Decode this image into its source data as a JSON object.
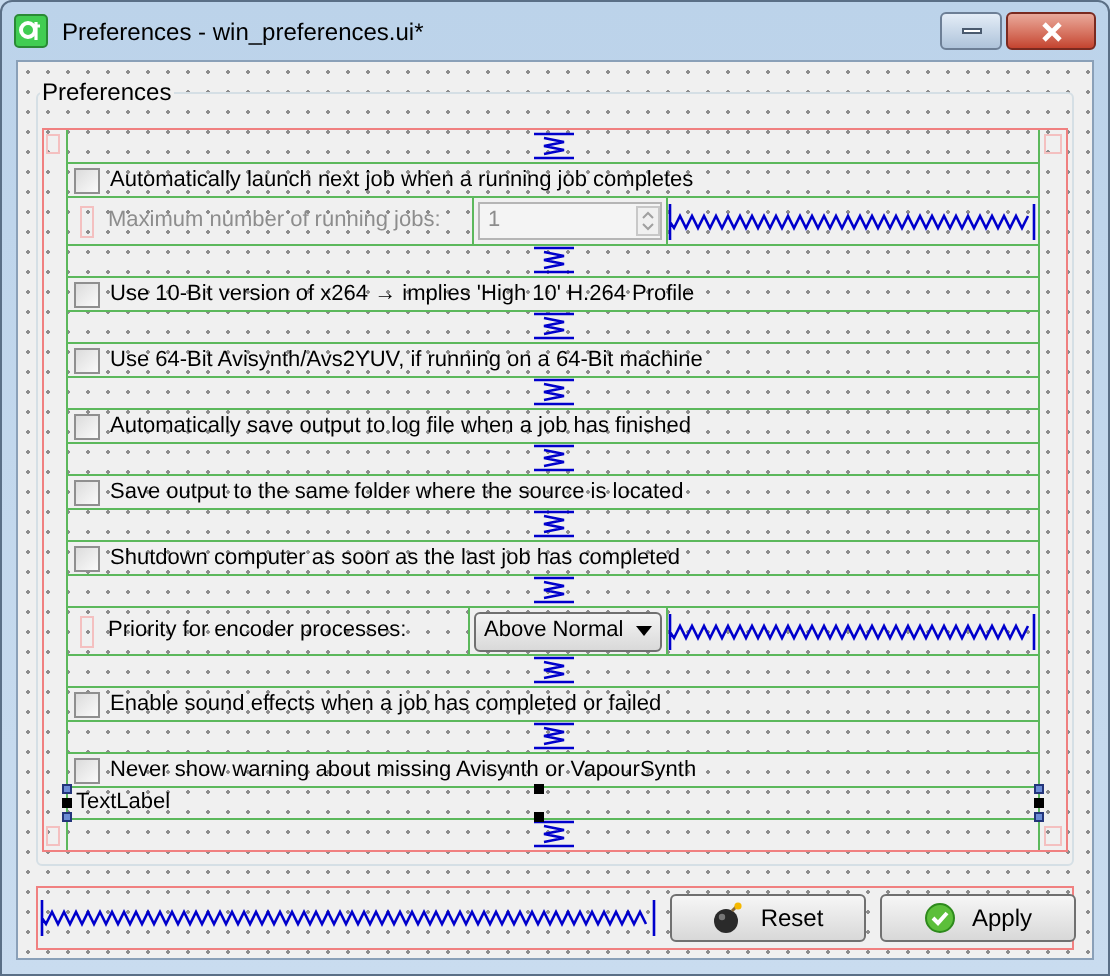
{
  "window": {
    "title": "Preferences - win_preferences.ui*"
  },
  "group": {
    "title": "Preferences"
  },
  "items": [
    {
      "kind": "spacer"
    },
    {
      "kind": "checkbox",
      "label": "Automatically launch next job when a running job completes",
      "checked": false
    },
    {
      "kind": "spin",
      "label": "Maximum number of running jobs:",
      "value": "1",
      "disabled": true
    },
    {
      "kind": "spacer"
    },
    {
      "kind": "checkbox",
      "label": "Use 10-Bit version of x264 → implies 'High 10' H.264 Profile",
      "checked": false
    },
    {
      "kind": "spacer"
    },
    {
      "kind": "checkbox",
      "label": "Use 64-Bit Avisynth/Avs2YUV, if running on a 64-Bit machine",
      "checked": false
    },
    {
      "kind": "spacer"
    },
    {
      "kind": "checkbox",
      "label": "Automatically save output to log file when a job has finished",
      "checked": false
    },
    {
      "kind": "spacer"
    },
    {
      "kind": "checkbox",
      "label": "Save output to the same folder where the source is located",
      "checked": false
    },
    {
      "kind": "spacer"
    },
    {
      "kind": "checkbox",
      "label": "Shutdown computer as soon as the last job has completed",
      "checked": false
    },
    {
      "kind": "spacer"
    },
    {
      "kind": "combo",
      "label": "Priority for encoder processes:",
      "value": "Above Normal"
    },
    {
      "kind": "spacer"
    },
    {
      "kind": "checkbox",
      "label": "Enable sound effects when a job has completed or failed",
      "checked": false
    },
    {
      "kind": "spacer"
    },
    {
      "kind": "checkbox",
      "label": "Never show warning about missing Avisynth or VapourSynth",
      "checked": false
    },
    {
      "kind": "label",
      "text": "TextLabel",
      "selected": true
    },
    {
      "kind": "spacer"
    }
  ],
  "buttons": [
    {
      "kind": "reset",
      "label": "Reset"
    },
    {
      "kind": "apply",
      "label": "Apply"
    }
  ]
}
